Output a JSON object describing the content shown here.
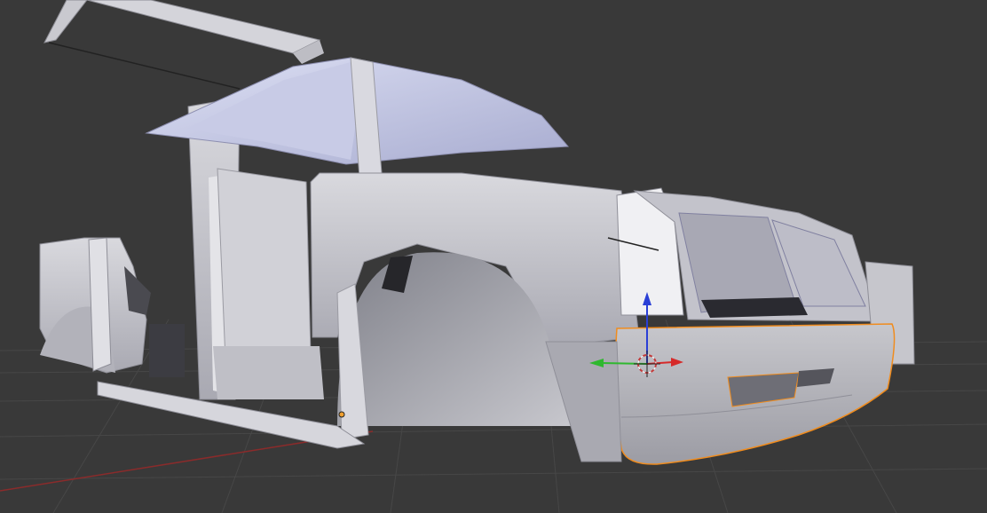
{
  "app": {
    "name": "3D Viewport"
  },
  "viewport": {
    "background_color": "#393939",
    "grid_color": "#474747",
    "x_axis_color": "#8a2b2b",
    "mesh_color": "#c9c9cf",
    "mesh_shadow_color": "#8c8c96",
    "interior_color": "#b9bcd6",
    "selection_outline_color": "#f08c1e",
    "overlay_text": ""
  },
  "gizmo": {
    "type": "translate",
    "x_axis_color": "#d62a2a",
    "y_axis_color": "#2fb82f",
    "z_axis_color": "#2a3fd6",
    "cursor_color": "#c43a3a"
  },
  "scene": {
    "object": "car-body-mesh",
    "selected_part": "front-bumper"
  }
}
